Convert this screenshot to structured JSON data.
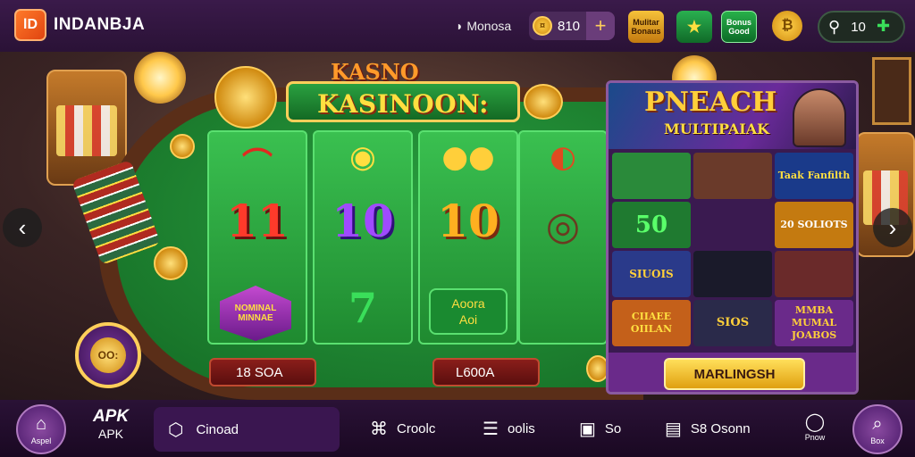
{
  "header": {
    "logo_text": "lD",
    "brand": "INDANBJA",
    "currency_label": "Monosa",
    "balance": "810",
    "plus": "+",
    "promo_icons": [
      "Mulitar Bonaus",
      "★",
      "Bonus Good",
      "₿"
    ],
    "user_count": "10"
  },
  "scene": {
    "slot_sub_title": "KASNO",
    "slot_title": "KASINOON:",
    "reels": [
      {
        "icon": "cap-icon",
        "number": "11",
        "badge": "NOMINAL MINNAE"
      },
      {
        "icon": "barrel-icon",
        "number": "10",
        "badge": ""
      },
      {
        "icon": "coins-icon",
        "number": "10",
        "badge_line1": "Aoora",
        "badge_line2": "Aoi"
      },
      {
        "icon": "chip-icon",
        "number": "",
        "badge": ""
      }
    ],
    "bet_1": "18 SOA",
    "bet_2": "L600A",
    "big_chip": "OO:"
  },
  "promo": {
    "title": "PNEACH",
    "subtitle": "MULTIPAIAK",
    "tiles": [
      "",
      "",
      "Taak Fanfilth",
      "50",
      "",
      "20 SOLIOTS",
      "SIUOIS",
      "",
      "",
      "CIIAEE OIILAN",
      "SIOS",
      "MMBA MUMAL JOABOS"
    ],
    "button": "MARLINGSH"
  },
  "nav": {
    "home_label": "Aspel",
    "apk_top": "APK",
    "apk_bottom": "APK",
    "active_label": "Cinoad",
    "items": [
      "Croolc",
      "oolis",
      "So",
      "S8 Osonn"
    ],
    "small_label": "Pnow",
    "right_label": "Box"
  },
  "colors": {
    "background": "#1a0d22",
    "felt": "#2aa040",
    "gold": "#ffcf3a",
    "purple": "#6a2a8a"
  }
}
